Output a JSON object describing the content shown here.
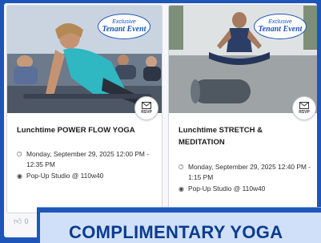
{
  "cards": [
    {
      "badge_line1": "Exclusive",
      "badge_line2": "Tenant Event",
      "rsvp_label": "RSVP",
      "title": "Lunchtime POWER FLOW YOGA",
      "time": "Monday, September 29, 2025 12:00 PM - 12:35 PM",
      "location": "Pop-Up Studio @ 110w40"
    },
    {
      "badge_line1": "Exclusive",
      "badge_line2": "Tenant Event",
      "rsvp_label": "RSVP",
      "title": "Lunchtime STRETCH & MEDITATION",
      "time": "Monday, September 29, 2025 12:40 PM - 1:15 PM",
      "location": "Pop-Up Studio @ 110w40"
    }
  ],
  "likes": {
    "count": "0",
    "icon": "thumbs-up-icon"
  },
  "banner": {
    "text": "COMPLIMENTARY YOGA"
  },
  "colors": {
    "brand_blue": "#1e55b9",
    "banner_bg": "#cfe0f8",
    "banner_text": "#0c3b8e"
  }
}
